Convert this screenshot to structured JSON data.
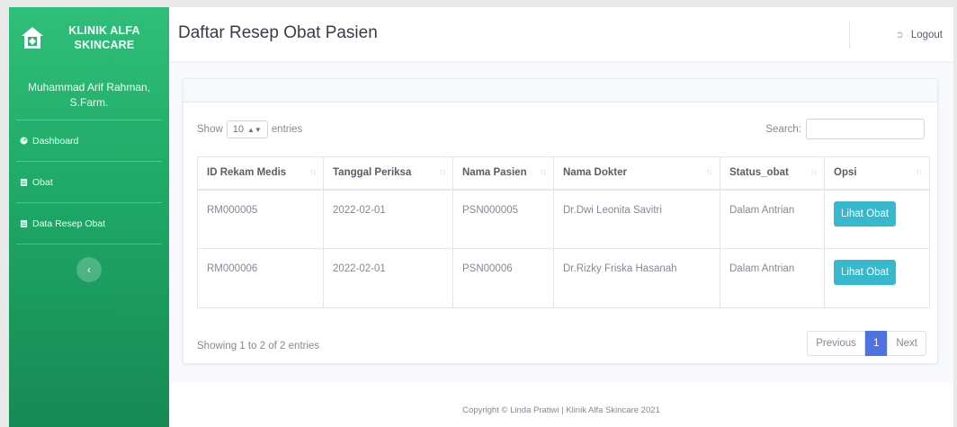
{
  "brand": {
    "line1": "KLINIK ALFA",
    "line2": "SKINCARE"
  },
  "user": {
    "line1": "Muhammad Arif Rahman,",
    "line2": "S.Farm."
  },
  "sidebar": {
    "items": [
      {
        "label": "Dashboard",
        "icon": "dashboard-icon"
      },
      {
        "label": "Obat",
        "icon": "clipboard-icon"
      },
      {
        "label": "Data Resep Obat",
        "icon": "clipboard-icon"
      }
    ],
    "toggle_icon": "chevron-left-icon"
  },
  "header": {
    "title": "Daftar Resep Obat Pasien",
    "logout_label": "Logout"
  },
  "table_controls": {
    "show_label": "Show",
    "entries_value": "10",
    "entries_label": "entries",
    "search_label": "Search:",
    "search_value": ""
  },
  "table": {
    "columns": [
      "ID Rekam Medis",
      "Tanggal Periksa",
      "Nama Pasien",
      "Nama Dokter",
      "Status_obat",
      "Opsi"
    ],
    "rows": [
      {
        "id": "RM000005",
        "tanggal": "2022-02-01",
        "pasien": "PSN000005",
        "dokter": "Dr.Dwi Leonita Savitri",
        "status": "Dalam Antrian",
        "action": "Lihat Obat"
      },
      {
        "id": "RM000006",
        "tanggal": "2022-02-01",
        "pasien": "PSN00006",
        "dokter": "Dr.Rizky Friska Hasanah",
        "status": "Dalam Antrian",
        "action": "Lihat Obat"
      }
    ]
  },
  "pagination": {
    "info": "Showing 1 to 2 of 2 entries",
    "previous": "Previous",
    "current": "1",
    "next": "Next"
  },
  "footer": {
    "text": "Copyright © Linda Pratiwi | Klinik Alfa Skincare 2021"
  },
  "colors": {
    "sidebar_green": "#1fa866",
    "info_button": "#36b9cc",
    "active_page": "#4e73df"
  }
}
